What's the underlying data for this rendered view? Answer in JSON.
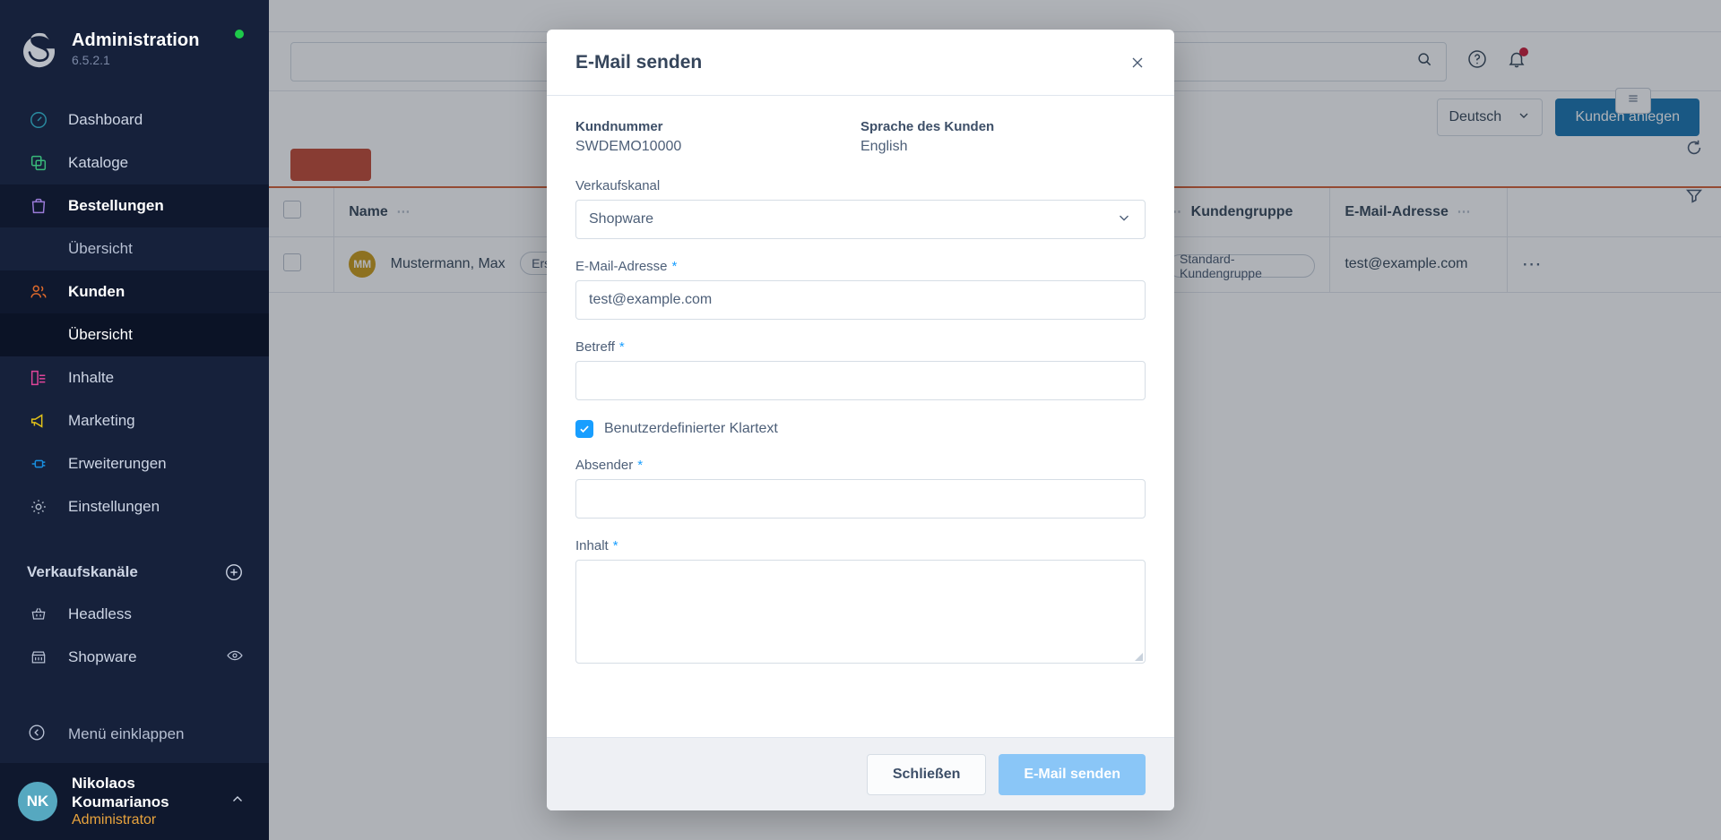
{
  "sidebar": {
    "title": "Administration",
    "version": "6.5.2.1",
    "status_dot_color": "#1ec94a",
    "items": [
      {
        "label": "Dashboard",
        "icon": "gauge-icon",
        "color": "#2a8ba0",
        "type": "main"
      },
      {
        "label": "Kataloge",
        "icon": "copy-icon",
        "color": "#39b97a",
        "type": "main"
      },
      {
        "label": "Bestellungen",
        "icon": "bag-icon",
        "color": "#9a7bd8",
        "type": "main",
        "state": "active-parent"
      },
      {
        "label": "Übersicht",
        "icon": "",
        "color": "",
        "type": "sub"
      },
      {
        "label": "Kunden",
        "icon": "users-icon",
        "color": "#e06a2b",
        "type": "main",
        "state": "active-parent"
      },
      {
        "label": "Übersicht",
        "icon": "",
        "color": "",
        "type": "sub",
        "state": "active-sub"
      },
      {
        "label": "Inhalte",
        "icon": "content-icon",
        "color": "#e0459a",
        "type": "main"
      },
      {
        "label": "Marketing",
        "icon": "megaphone-icon",
        "color": "#e3c319",
        "type": "main"
      },
      {
        "label": "Erweiterungen",
        "icon": "plugin-icon",
        "color": "#188fe0",
        "type": "main"
      },
      {
        "label": "Einstellungen",
        "icon": "gear-icon",
        "color": "#aab4c4",
        "type": "main"
      }
    ],
    "sales_channels_heading": "Verkaufskanäle",
    "sales_channels": [
      {
        "label": "Headless",
        "icon": "basket-icon",
        "trailing_icon": ""
      },
      {
        "label": "Shopware",
        "icon": "storefront-icon",
        "trailing_icon": "eye-icon"
      }
    ],
    "collapse_label": "Menü einklappen",
    "user": {
      "initials": "NK",
      "name": "Nikolaos Koumarianos",
      "role": "Administrator",
      "avatar_color": "#56a8c0",
      "role_color": "#e8a33d"
    }
  },
  "topbar": {
    "search_placeholder": "",
    "help_icon": "help-circle-icon",
    "notifications_icon": "bell-icon",
    "notification_badge_color": "#c8102e"
  },
  "toolbar": {
    "language_value": "Deutsch",
    "create_customer_label": "Kunden anlegen",
    "danger_label": ""
  },
  "table": {
    "accent_color": "#d4572b",
    "columns": [
      "",
      "Name",
      "",
      "Kundengruppe",
      "E-Mail-Adresse",
      ""
    ],
    "rows": [
      {
        "avatar_initials": "MM",
        "name": "Mustermann, Max",
        "tag": "Erst",
        "customer_group": "Standard-Kundengruppe",
        "email": "test@example.com"
      }
    ],
    "rail": {
      "refresh_icon": "refresh-icon",
      "filter_icon": "filter-icon",
      "columns_icon": "columns-icon"
    }
  },
  "modal": {
    "title": "E-Mail senden",
    "close_icon": "close-icon",
    "customer_number_label": "Kundnummer",
    "customer_number_value": "SWDEMO10000",
    "language_label": "Sprache des Kunden",
    "language_value": "English",
    "sales_channel_label": "Verkaufskanal",
    "sales_channel_value": "Shopware",
    "email_label": "E-Mail-Adresse",
    "email_required": "*",
    "email_value": "test@example.com",
    "subject_label": "Betreff",
    "subject_required": "*",
    "subject_value": "",
    "plaintext_checkbox_label": "Benutzerdefinierter Klartext",
    "plaintext_checked": true,
    "sender_label": "Absender",
    "sender_required": "*",
    "sender_value": "",
    "content_label": "Inhalt",
    "content_required": "*",
    "content_value": "",
    "close_button": "Schließen",
    "send_button": "E-Mail senden",
    "accent_color": "#189eff",
    "send_button_color": "#8ac6f7"
  }
}
